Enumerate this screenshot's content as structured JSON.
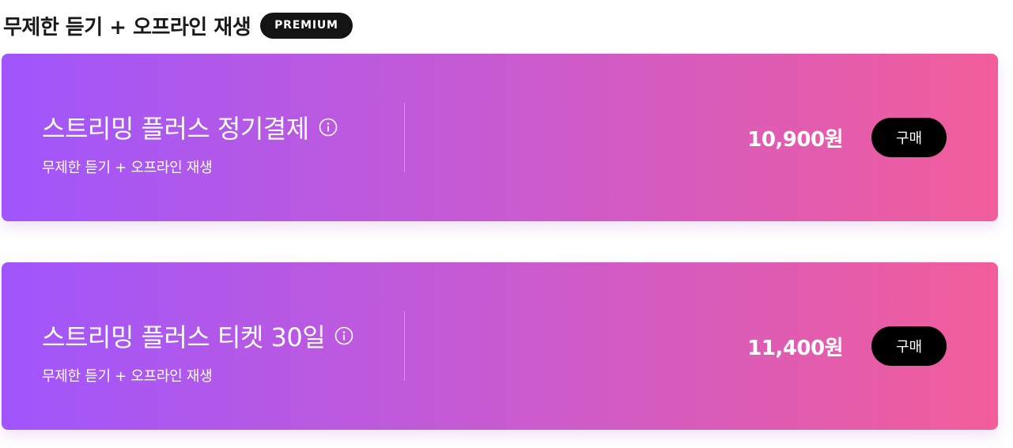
{
  "header": {
    "title": "무제한 듣기 + 오프라인 재생",
    "badge": "PREMIUM"
  },
  "products": [
    {
      "title": "스트리밍 플러스 정기결제",
      "subtitle": "무제한 듣기 + 오프라인 재생",
      "price": "10,900원",
      "button_label": "구매",
      "info_icon": "info-circle-icon"
    },
    {
      "title": "스트리밍 플러스 티켓 30일",
      "subtitle": "무제한 듣기 + 오프라인 재생",
      "price": "11,400원",
      "button_label": "구매",
      "info_icon": "info-circle-icon"
    }
  ],
  "colors": {
    "gradient_start": "#a056fc",
    "gradient_end": "#f25d9a",
    "badge_bg": "#141414",
    "button_bg": "#000000"
  }
}
